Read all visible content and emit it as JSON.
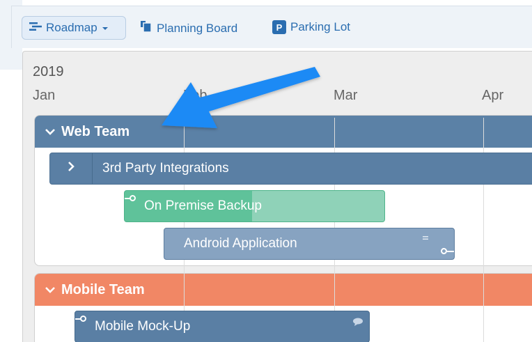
{
  "toolbar": {
    "roadmap_label": "Roadmap",
    "planning_board_label": "Planning Board",
    "parking_lot_label": "Parking Lot",
    "parking_lot_badge": "P"
  },
  "timeline": {
    "year": "2019",
    "months": [
      "Jan",
      "Feb",
      "Mar",
      "Apr"
    ]
  },
  "groups": [
    {
      "name": "Web Team",
      "color": "#5b81a6",
      "items": [
        {
          "name": "3rd Party Integrations",
          "color": "#5a7fa4"
        },
        {
          "name": "On Premise Backup",
          "color": "#5fc29a"
        },
        {
          "name": "Android Application",
          "color": "#87a3c1"
        }
      ]
    },
    {
      "name": "Mobile Team",
      "color": "#f18765",
      "items": [
        {
          "name": "Mobile Mock-Up",
          "color": "#5a7fa4"
        }
      ]
    }
  ],
  "annotation": {
    "arrow_color": "#1f8af5"
  },
  "icons": {
    "roadmap": "roadmap-icon",
    "planning_board": "planning-board-icon",
    "dropdown": "caret-down-icon"
  }
}
